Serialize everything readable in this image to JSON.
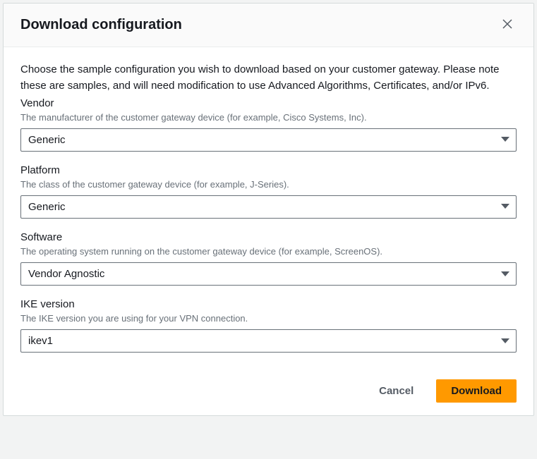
{
  "header": {
    "title": "Download configuration"
  },
  "intro": "Choose the sample configuration you wish to download based on your customer gateway. Please note these are samples, and will need modification to use Advanced Algorithms, Certificates, and/or IPv6.",
  "fields": {
    "vendor": {
      "label": "Vendor",
      "help": "The manufacturer of the customer gateway device (for example, Cisco Systems, Inc).",
      "value": "Generic"
    },
    "platform": {
      "label": "Platform",
      "help": "The class of the customer gateway device (for example, J-Series).",
      "value": "Generic"
    },
    "software": {
      "label": "Software",
      "help": "The operating system running on the customer gateway device (for example, ScreenOS).",
      "value": "Vendor Agnostic"
    },
    "ike": {
      "label": "IKE version",
      "help": "The IKE version you are using for your VPN connection.",
      "value": "ikev1"
    }
  },
  "footer": {
    "cancel": "Cancel",
    "download": "Download"
  }
}
